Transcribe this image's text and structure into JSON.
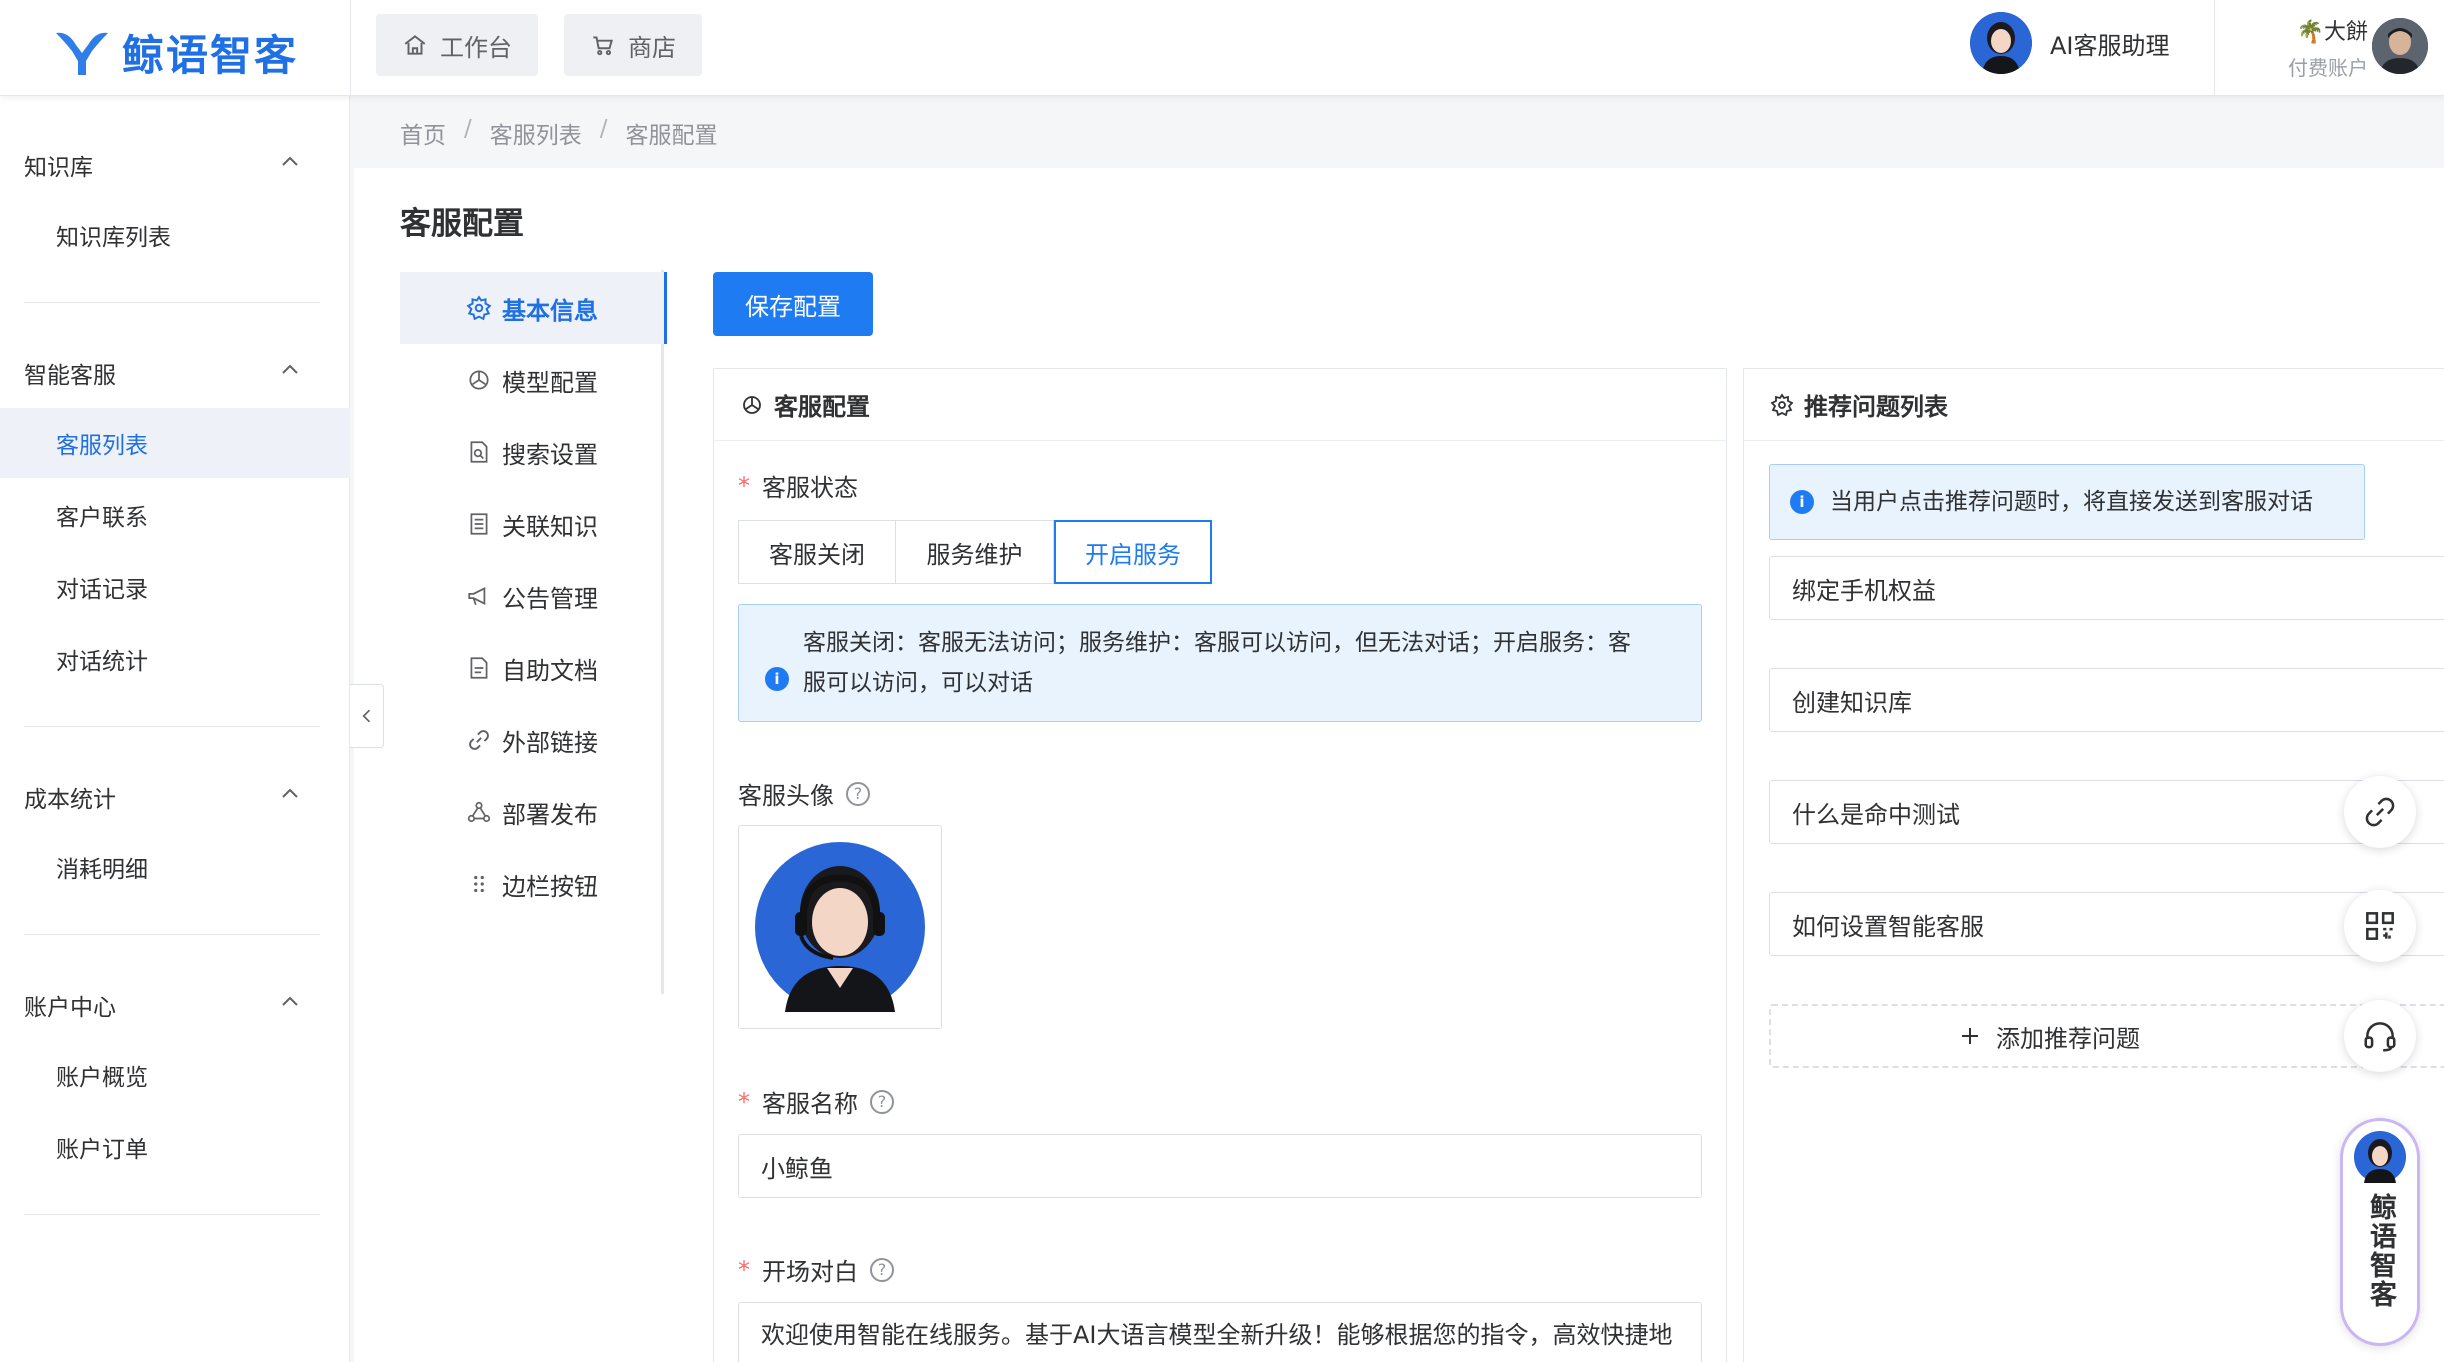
{
  "brand": {
    "name": "鲸语智客",
    "color": "#1f6fe5"
  },
  "topbar": {
    "tabs": [
      {
        "label": "工作台",
        "icon": "home-icon"
      },
      {
        "label": "商店",
        "icon": "cart-icon"
      }
    ],
    "assistant_label": "AI客服助理",
    "user": {
      "name": "大餅",
      "plan": "付费账户"
    }
  },
  "sidebar": {
    "groups": [
      {
        "title": "知识库",
        "items": [
          "知识库列表"
        ]
      },
      {
        "title": "智能客服",
        "items": [
          "客服列表",
          "客户联系",
          "对话记录",
          "对话统计"
        ]
      },
      {
        "title": "成本统计",
        "items": [
          "消耗明细"
        ]
      },
      {
        "title": "账户中心",
        "items": [
          "账户概览",
          "账户订单"
        ]
      }
    ],
    "active_item": "客服列表"
  },
  "breadcrumb": [
    "首页",
    "客服列表",
    "客服配置"
  ],
  "page_title": "客服配置",
  "config_tabs": [
    {
      "label": "基本信息",
      "icon": "gear-icon",
      "active": true
    },
    {
      "label": "模型配置",
      "icon": "openai-icon"
    },
    {
      "label": "搜索设置",
      "icon": "search-doc-icon"
    },
    {
      "label": "关联知识",
      "icon": "book-icon"
    },
    {
      "label": "公告管理",
      "icon": "megaphone-icon"
    },
    {
      "label": "自助文档",
      "icon": "doc-icon"
    },
    {
      "label": "外部链接",
      "icon": "link-icon"
    },
    {
      "label": "部署发布",
      "icon": "deploy-icon"
    },
    {
      "label": "边栏按钮",
      "icon": "drag-dots-icon"
    }
  ],
  "save_button": "保存配置",
  "service_panel": {
    "title": "客服配置",
    "status": {
      "label": "客服状态",
      "options": [
        "客服关闭",
        "服务维护",
        "开启服务"
      ],
      "selected": "开启服务",
      "info_line1": "客服关闭：客服无法访问；服务维护：客服可以访问，但无法对话；开启服务：客",
      "info_line2": "服可以访问，可以对话"
    },
    "avatar_label": "客服头像",
    "name": {
      "label": "客服名称",
      "value": "小鲸鱼"
    },
    "greeting": {
      "label": "开场对白",
      "value": "欢迎使用智能在线服务。基于AI大语言模型全新升级！能够根据您的指令，高效快捷地"
    }
  },
  "recommend_panel": {
    "title": "推荐问题列表",
    "info": "当用户点击推荐问题时，将直接发送到客服对话",
    "questions": [
      "绑定手机权益",
      "创建知识库",
      "什么是命中测试",
      "如何设置智能客服"
    ],
    "add_label": "添加推荐问题"
  },
  "floating": {
    "chat_label": "鲸语智客"
  },
  "colors": {
    "primary": "#1f7bf2",
    "required": "#f56c6c",
    "info_bg": "#e8f3fe"
  }
}
